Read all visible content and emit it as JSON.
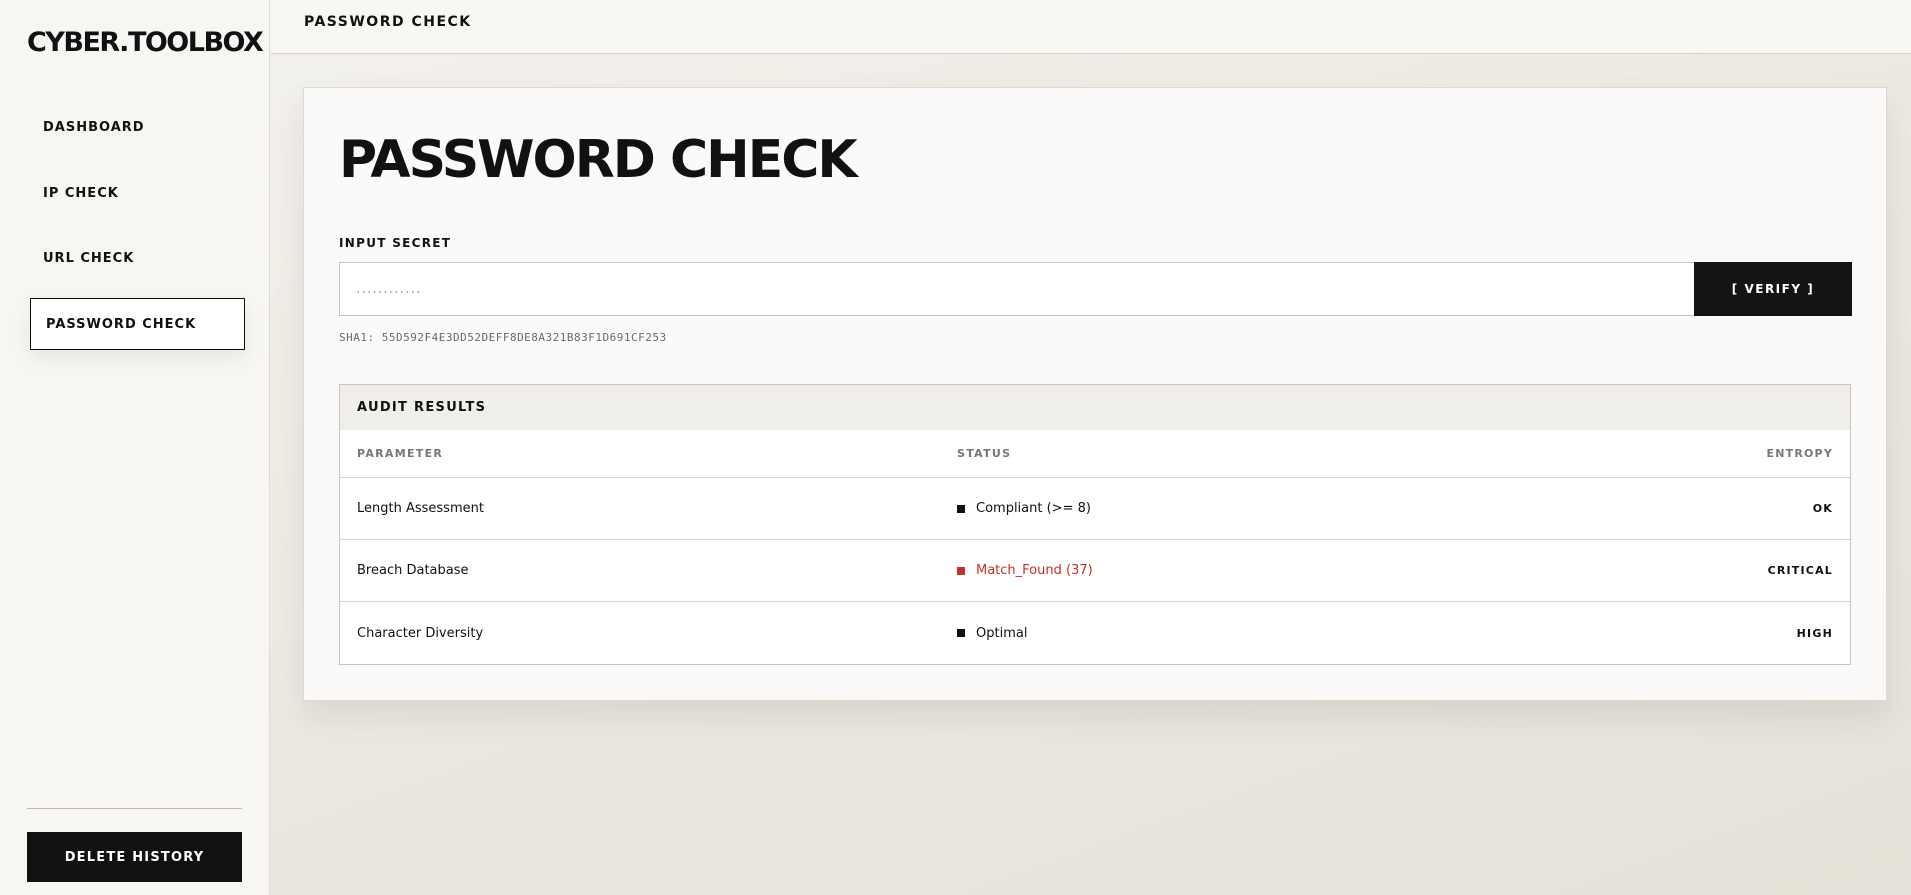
{
  "app": {
    "logo": "CYBER.TOOLBOX"
  },
  "sidebar": {
    "items": [
      {
        "label": "DASHBOARD"
      },
      {
        "label": "IP CHECK"
      },
      {
        "label": "URL CHECK"
      },
      {
        "label": "PASSWORD CHECK",
        "active": true
      }
    ],
    "delete_label": "DELETE HISTORY"
  },
  "topbar": {
    "title": "PASSWORD CHECK"
  },
  "main": {
    "title": "PASSWORD CHECK",
    "input_label": "INPUT SECRET",
    "input_placeholder": "............",
    "verify_label": "[ VERIFY ]",
    "sha_line": "SHA1: 55D592F4E3DD52DEFF8DE8A321B83F1D691CF253"
  },
  "results": {
    "heading": "AUDIT RESULTS",
    "columns": [
      "PARAMETER",
      "STATUS",
      "ENTROPY"
    ],
    "rows": [
      {
        "parameter": "Length Assessment",
        "status": "Compliant (>= 8)",
        "entropy": "OK"
      },
      {
        "parameter": "Breach Database",
        "status": "Match_Found (37)",
        "entropy": "CRITICAL"
      },
      {
        "parameter": "Character Diversity",
        "status": "Optimal",
        "entropy": "HIGH"
      }
    ]
  },
  "colors": {
    "accent": "#111111",
    "danger": "#c0322e",
    "background": "#ebe7df"
  }
}
